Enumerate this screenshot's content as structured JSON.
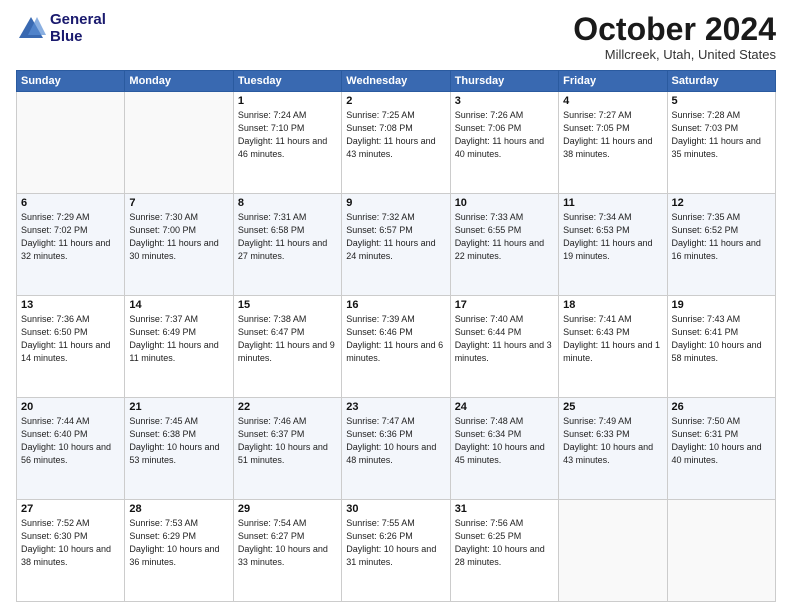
{
  "header": {
    "logo_line1": "General",
    "logo_line2": "Blue",
    "title": "October 2024",
    "location": "Millcreek, Utah, United States"
  },
  "weekdays": [
    "Sunday",
    "Monday",
    "Tuesday",
    "Wednesday",
    "Thursday",
    "Friday",
    "Saturday"
  ],
  "weeks": [
    [
      {
        "day": "",
        "info": ""
      },
      {
        "day": "",
        "info": ""
      },
      {
        "day": "1",
        "info": "Sunrise: 7:24 AM\nSunset: 7:10 PM\nDaylight: 11 hours and 46 minutes."
      },
      {
        "day": "2",
        "info": "Sunrise: 7:25 AM\nSunset: 7:08 PM\nDaylight: 11 hours and 43 minutes."
      },
      {
        "day": "3",
        "info": "Sunrise: 7:26 AM\nSunset: 7:06 PM\nDaylight: 11 hours and 40 minutes."
      },
      {
        "day": "4",
        "info": "Sunrise: 7:27 AM\nSunset: 7:05 PM\nDaylight: 11 hours and 38 minutes."
      },
      {
        "day": "5",
        "info": "Sunrise: 7:28 AM\nSunset: 7:03 PM\nDaylight: 11 hours and 35 minutes."
      }
    ],
    [
      {
        "day": "6",
        "info": "Sunrise: 7:29 AM\nSunset: 7:02 PM\nDaylight: 11 hours and 32 minutes."
      },
      {
        "day": "7",
        "info": "Sunrise: 7:30 AM\nSunset: 7:00 PM\nDaylight: 11 hours and 30 minutes."
      },
      {
        "day": "8",
        "info": "Sunrise: 7:31 AM\nSunset: 6:58 PM\nDaylight: 11 hours and 27 minutes."
      },
      {
        "day": "9",
        "info": "Sunrise: 7:32 AM\nSunset: 6:57 PM\nDaylight: 11 hours and 24 minutes."
      },
      {
        "day": "10",
        "info": "Sunrise: 7:33 AM\nSunset: 6:55 PM\nDaylight: 11 hours and 22 minutes."
      },
      {
        "day": "11",
        "info": "Sunrise: 7:34 AM\nSunset: 6:53 PM\nDaylight: 11 hours and 19 minutes."
      },
      {
        "day": "12",
        "info": "Sunrise: 7:35 AM\nSunset: 6:52 PM\nDaylight: 11 hours and 16 minutes."
      }
    ],
    [
      {
        "day": "13",
        "info": "Sunrise: 7:36 AM\nSunset: 6:50 PM\nDaylight: 11 hours and 14 minutes."
      },
      {
        "day": "14",
        "info": "Sunrise: 7:37 AM\nSunset: 6:49 PM\nDaylight: 11 hours and 11 minutes."
      },
      {
        "day": "15",
        "info": "Sunrise: 7:38 AM\nSunset: 6:47 PM\nDaylight: 11 hours and 9 minutes."
      },
      {
        "day": "16",
        "info": "Sunrise: 7:39 AM\nSunset: 6:46 PM\nDaylight: 11 hours and 6 minutes."
      },
      {
        "day": "17",
        "info": "Sunrise: 7:40 AM\nSunset: 6:44 PM\nDaylight: 11 hours and 3 minutes."
      },
      {
        "day": "18",
        "info": "Sunrise: 7:41 AM\nSunset: 6:43 PM\nDaylight: 11 hours and 1 minute."
      },
      {
        "day": "19",
        "info": "Sunrise: 7:43 AM\nSunset: 6:41 PM\nDaylight: 10 hours and 58 minutes."
      }
    ],
    [
      {
        "day": "20",
        "info": "Sunrise: 7:44 AM\nSunset: 6:40 PM\nDaylight: 10 hours and 56 minutes."
      },
      {
        "day": "21",
        "info": "Sunrise: 7:45 AM\nSunset: 6:38 PM\nDaylight: 10 hours and 53 minutes."
      },
      {
        "day": "22",
        "info": "Sunrise: 7:46 AM\nSunset: 6:37 PM\nDaylight: 10 hours and 51 minutes."
      },
      {
        "day": "23",
        "info": "Sunrise: 7:47 AM\nSunset: 6:36 PM\nDaylight: 10 hours and 48 minutes."
      },
      {
        "day": "24",
        "info": "Sunrise: 7:48 AM\nSunset: 6:34 PM\nDaylight: 10 hours and 45 minutes."
      },
      {
        "day": "25",
        "info": "Sunrise: 7:49 AM\nSunset: 6:33 PM\nDaylight: 10 hours and 43 minutes."
      },
      {
        "day": "26",
        "info": "Sunrise: 7:50 AM\nSunset: 6:31 PM\nDaylight: 10 hours and 40 minutes."
      }
    ],
    [
      {
        "day": "27",
        "info": "Sunrise: 7:52 AM\nSunset: 6:30 PM\nDaylight: 10 hours and 38 minutes."
      },
      {
        "day": "28",
        "info": "Sunrise: 7:53 AM\nSunset: 6:29 PM\nDaylight: 10 hours and 36 minutes."
      },
      {
        "day": "29",
        "info": "Sunrise: 7:54 AM\nSunset: 6:27 PM\nDaylight: 10 hours and 33 minutes."
      },
      {
        "day": "30",
        "info": "Sunrise: 7:55 AM\nSunset: 6:26 PM\nDaylight: 10 hours and 31 minutes."
      },
      {
        "day": "31",
        "info": "Sunrise: 7:56 AM\nSunset: 6:25 PM\nDaylight: 10 hours and 28 minutes."
      },
      {
        "day": "",
        "info": ""
      },
      {
        "day": "",
        "info": ""
      }
    ]
  ]
}
